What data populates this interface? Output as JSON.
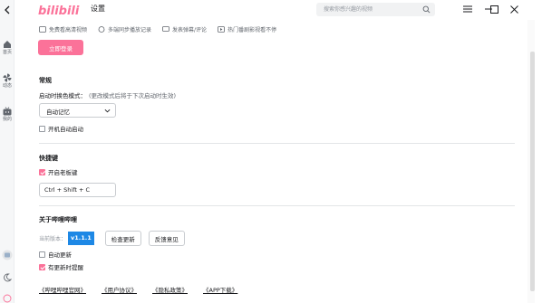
{
  "app": {
    "logo_text": "bilibili",
    "title": "设置",
    "brand_color": "#fb7299",
    "search_placeholder": "搜索你感兴趣的视频"
  },
  "sidebar": {
    "items": [
      {
        "label": "首页",
        "icon": "home-icon"
      },
      {
        "label": "动态",
        "icon": "fan-icon"
      },
      {
        "label": "我的",
        "icon": "tv-icon"
      }
    ],
    "bottom_icons": [
      "avatar",
      "moon-icon",
      "logout-icon"
    ]
  },
  "promo": {
    "items": [
      {
        "label": "免费看高清视频",
        "icon": "hd-icon"
      },
      {
        "label": "多端同步播放记录",
        "icon": "sync-icon"
      },
      {
        "label": "发表弹幕/评论",
        "icon": "comment-icon"
      },
      {
        "label": "热门番剧影视看不停",
        "icon": "play-icon"
      }
    ],
    "login_label": "立即登录"
  },
  "general": {
    "title": "常规",
    "theme_label": "启动时换色模式：",
    "theme_hint": "(更改模式后将于下次启动时生效)",
    "theme_value": "自动记忆",
    "autostart_label": "开机自动启动",
    "autostart_checked": false
  },
  "shortcuts": {
    "title": "快捷键",
    "boss_key_label": "开启老板键",
    "boss_key_checked": true,
    "combo": "Ctrl + Shift + C"
  },
  "about": {
    "title": "关于哔哩哔哩",
    "version_label": "当前版本：",
    "version": "v1.1.1",
    "check_update_label": "检查更新",
    "feedback_label": "反馈意见",
    "auto_update_label": "自动更新",
    "auto_update_checked": false,
    "notify_label": "有更新时提醒",
    "notify_checked": true
  },
  "links": [
    "《哔哩哔哩官网》",
    "《用户协议》",
    "《隐私政策》",
    "《APP下载》"
  ]
}
